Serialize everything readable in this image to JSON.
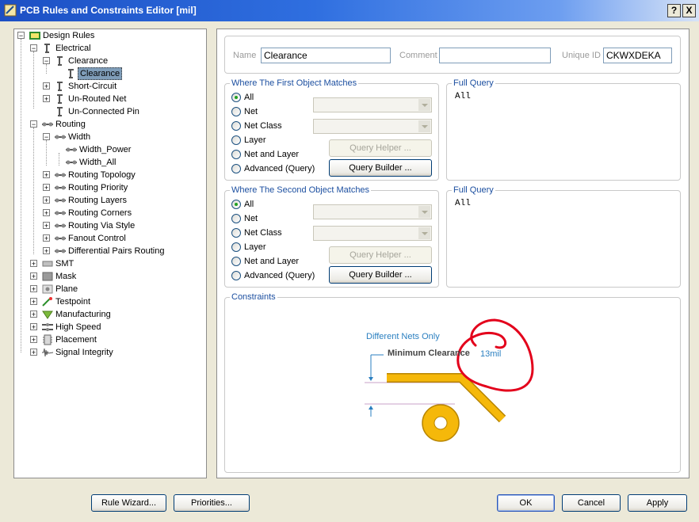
{
  "window": {
    "title": "PCB Rules and Constraints Editor [mil]",
    "help_label": "?",
    "close_label": "X"
  },
  "tree": {
    "root": "Design Rules",
    "electrical": "Electrical",
    "clearance_group": "Clearance",
    "clearance_rule": "Clearance",
    "short_circuit": "Short-Circuit",
    "unrouted_net": "Un-Routed Net",
    "unconnected_pin": "Un-Connected Pin",
    "routing": "Routing",
    "width": "Width",
    "width_power": "Width_Power",
    "width_all": "Width_All",
    "routing_topology": "Routing Topology",
    "routing_priority": "Routing Priority",
    "routing_layers": "Routing Layers",
    "routing_corners": "Routing Corners",
    "routing_via_style": "Routing Via Style",
    "fanout_control": "Fanout Control",
    "diff_pairs_routing": "Differential Pairs Routing",
    "smt": "SMT",
    "mask": "Mask",
    "plane": "Plane",
    "testpoint": "Testpoint",
    "manufacturing": "Manufacturing",
    "high_speed": "High Speed",
    "placement": "Placement",
    "signal_integrity": "Signal Integrity"
  },
  "rule": {
    "name_label": "Name",
    "name_value": "Clearance",
    "comment_label": "Comment",
    "comment_value": "",
    "unique_id_label": "Unique ID",
    "unique_id_value": "CKWXDEKA"
  },
  "first_match": {
    "title": "Where The First Object Matches",
    "options": [
      "All",
      "Net",
      "Net Class",
      "Layer",
      "Net and Layer",
      "Advanced (Query)"
    ],
    "selected": "All",
    "query_helper": "Query Helper ...",
    "query_builder": "Query Builder ...",
    "full_query_title": "Full Query",
    "full_query": "All"
  },
  "second_match": {
    "title": "Where The Second Object Matches",
    "options": [
      "All",
      "Net",
      "Net Class",
      "Layer",
      "Net and Layer",
      "Advanced (Query)"
    ],
    "selected": "All",
    "query_helper": "Query Helper ...",
    "query_builder": "Query Builder ...",
    "full_query_title": "Full Query",
    "full_query": "All"
  },
  "constraints": {
    "title": "Constraints",
    "different_nets": "Different Nets Only",
    "min_clearance_label": "Minimum Clearance",
    "min_clearance_value": "13mil"
  },
  "buttons": {
    "rule_wizard": "Rule Wizard...",
    "priorities": "Priorities...",
    "ok": "OK",
    "cancel": "Cancel",
    "apply": "Apply"
  },
  "colors": {
    "track": "#f5b80a",
    "annotation": "#e3001b",
    "accent": "#1c4fa0"
  }
}
